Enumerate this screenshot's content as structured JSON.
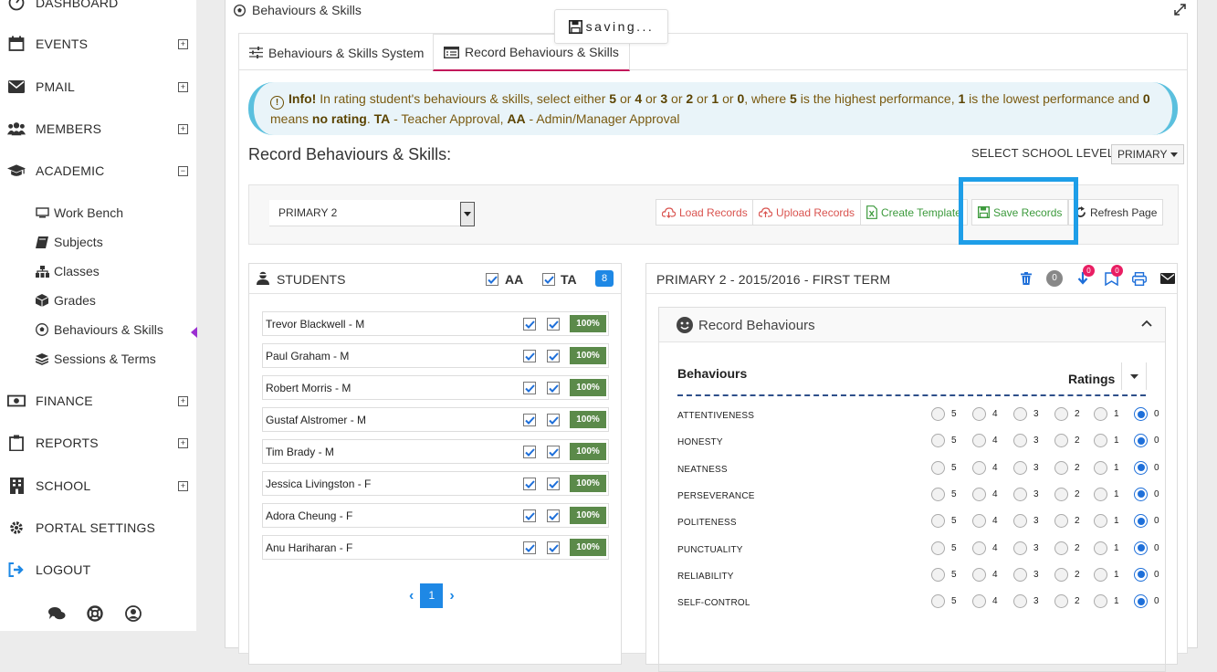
{
  "sidebar": {
    "items": [
      {
        "label": "DASHBOARD",
        "icon": "dashboard-icon",
        "expand": ""
      },
      {
        "label": "EVENTS",
        "icon": "calendar-icon",
        "expand": "+"
      },
      {
        "label": "PMAIL",
        "icon": "envelope-icon",
        "expand": "+"
      },
      {
        "label": "MEMBERS",
        "icon": "users-icon",
        "expand": "+"
      },
      {
        "label": "ACADEMIC",
        "icon": "graduation-cap-icon",
        "expand": "−"
      },
      {
        "label": "FINANCE",
        "icon": "money-icon",
        "expand": "+"
      },
      {
        "label": "REPORTS",
        "icon": "clipboard-icon",
        "expand": "+"
      },
      {
        "label": "SCHOOL",
        "icon": "building-icon",
        "expand": "+"
      },
      {
        "label": "PORTAL SETTINGS",
        "icon": "gear-icon",
        "expand": ""
      },
      {
        "label": "LOGOUT",
        "icon": "logout-icon",
        "expand": ""
      }
    ],
    "academic_sub": [
      {
        "label": "Work Bench",
        "icon": "monitor-icon"
      },
      {
        "label": "Subjects",
        "icon": "book-icon"
      },
      {
        "label": "Classes",
        "icon": "sitemap-icon"
      },
      {
        "label": "Grades",
        "icon": "cube-icon"
      },
      {
        "label": "Behaviours & Skills",
        "icon": "soccer-ball-icon"
      },
      {
        "label": "Sessions & Terms",
        "icon": "layers-icon"
      }
    ]
  },
  "panel": {
    "title": "Behaviours & Skills",
    "tabs": [
      "Behaviours & Skills System",
      "Record Behaviours & Skills"
    ],
    "saving": "saving..."
  },
  "info": {
    "prefix": "Info!",
    "text_1": " In rating student's behaviours & skills, select either ",
    "r5": "5",
    "or": " or ",
    "r4": "4",
    "r3": "3",
    "r2": "2",
    "r1": "1",
    "r0": "0",
    "text_2": ", where ",
    "text_3": " is the highest performance, ",
    "text_4": " is the lowest performance and ",
    "text_5": " means ",
    "no_rating": "no rating",
    "text_6": ". ",
    "ta": "TA",
    "ta_text": " - Teacher Approval, ",
    "aa": "AA",
    "aa_text": " - Admin/Manager Approval"
  },
  "record": {
    "heading": "Record Behaviours & Skills:",
    "school_level_label": "SELECT SCHOOL LEVEL",
    "school_level_value": "PRIMARY",
    "class_value": "PRIMARY 2",
    "buttons": {
      "load": "Load Records",
      "upload": "Upload Records",
      "template": "Create Template",
      "save": "Save Records",
      "refresh": "Refresh Page"
    }
  },
  "students": {
    "title": "STUDENTS",
    "aa": "AA",
    "ta": "TA",
    "count": "8",
    "rows": [
      {
        "name": "Trevor Blackwell - M",
        "pct": "100%"
      },
      {
        "name": "Paul Graham - M",
        "pct": "100%"
      },
      {
        "name": "Robert Morris - M",
        "pct": "100%"
      },
      {
        "name": "Gustaf Alstromer - M",
        "pct": "100%"
      },
      {
        "name": "Tim Brady - M",
        "pct": "100%"
      },
      {
        "name": "Jessica Livingston - F",
        "pct": "100%"
      },
      {
        "name": "Adora Cheung - F",
        "pct": "100%"
      },
      {
        "name": "Anu Hariharan - F",
        "pct": "100%"
      }
    ],
    "page": "1"
  },
  "term": {
    "title": "PRIMARY 2 - 2015/2016 - FIRST TERM",
    "grey_count": "0",
    "download_count": "0",
    "bookmark_count": "0"
  },
  "behaviours": {
    "card_title": "Record Behaviours",
    "col_behaviours": "Behaviours",
    "col_ratings": "Ratings",
    "scale": [
      "5",
      "4",
      "3",
      "2",
      "1",
      "0"
    ],
    "rows": [
      {
        "name": "ATTENTIVENESS",
        "selected": "0"
      },
      {
        "name": "HONESTY",
        "selected": "0"
      },
      {
        "name": "NEATNESS",
        "selected": "0"
      },
      {
        "name": "PERSEVERANCE",
        "selected": "0"
      },
      {
        "name": "POLITENESS",
        "selected": "0"
      },
      {
        "name": "PUNCTUALITY",
        "selected": "0"
      },
      {
        "name": "RELIABILITY",
        "selected": "0"
      },
      {
        "name": "SELF-CONTROL",
        "selected": "0"
      }
    ]
  },
  "colors": {
    "accent": "#1e88e5",
    "highlight": "#1e9ee8",
    "tab_underline": "#c2185b",
    "active_caret": "#9b2fd1",
    "success": "#5b8a4a"
  }
}
